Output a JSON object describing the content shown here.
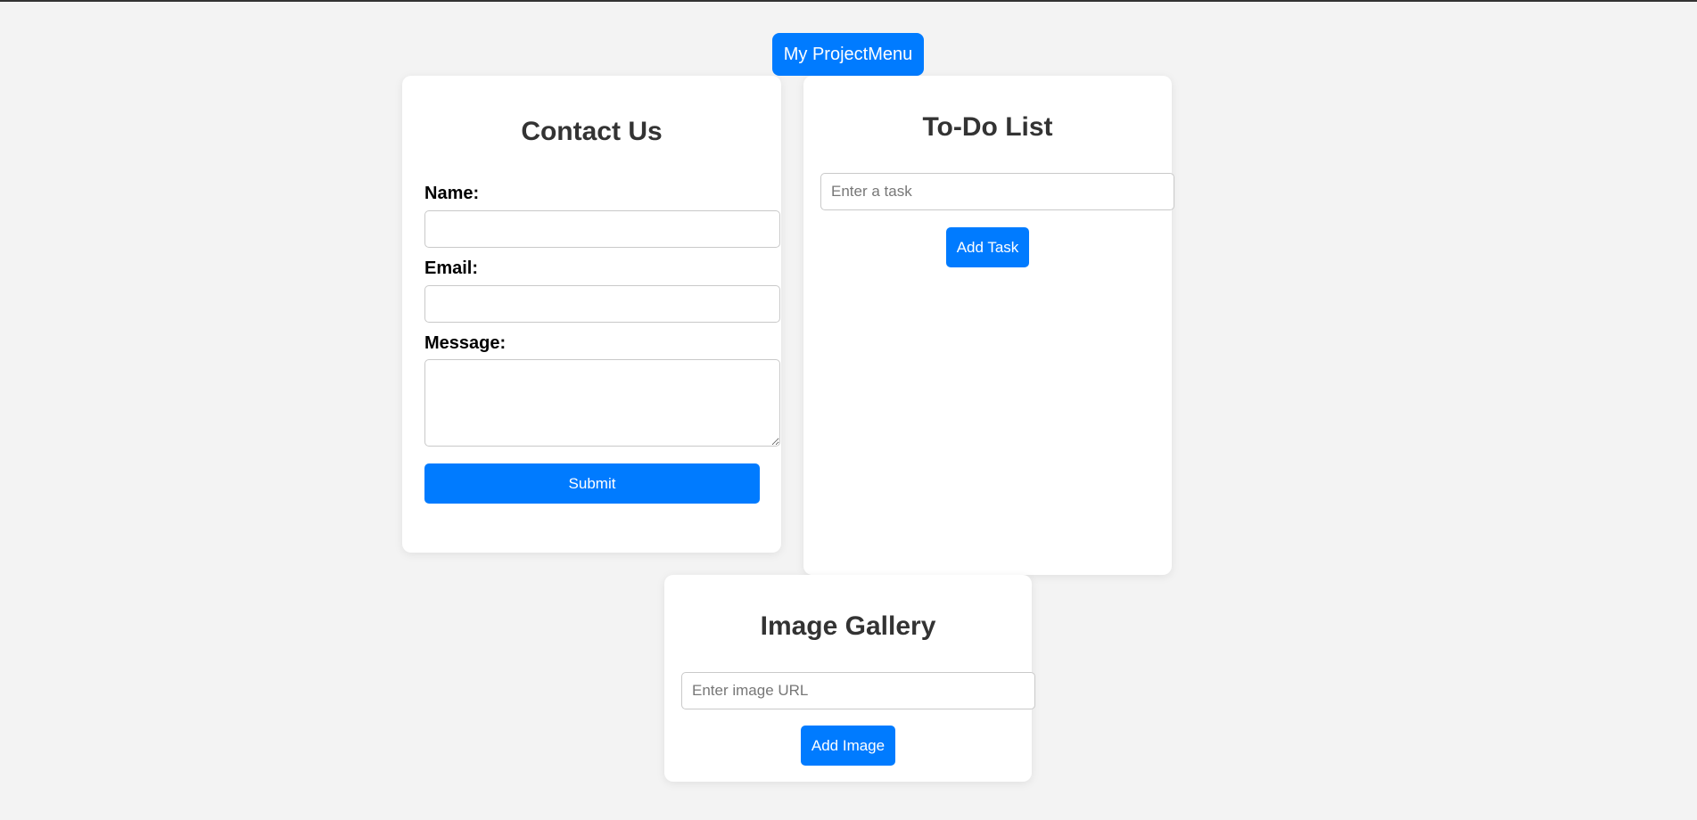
{
  "header": {
    "menu_label": "My ProjectMenu"
  },
  "contact": {
    "title": "Contact Us",
    "name_label": "Name:",
    "email_label": "Email:",
    "message_label": "Message:",
    "name_value": "",
    "email_value": "",
    "message_value": "",
    "submit_label": "Submit"
  },
  "todo": {
    "title": "To-Do List",
    "task_placeholder": "Enter a task",
    "add_label": "Add Task"
  },
  "gallery": {
    "title": "Image Gallery",
    "url_placeholder": "Enter image URL",
    "add_label": "Add Image"
  },
  "colors": {
    "accent": "#007bff",
    "background": "#f3f3f3",
    "card": "#ffffff",
    "heading": "#333333"
  }
}
